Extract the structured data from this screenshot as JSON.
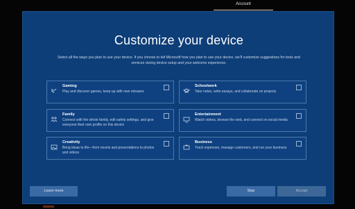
{
  "header": {
    "account_label": "Account"
  },
  "page": {
    "title": "Customize your device",
    "subtitle": "Select all the ways you plan to use your device. If you choose to tell Microsoft how you plan to use your device, we'll customize suggestions for tools and services during device setup and your welcome experience."
  },
  "options": [
    {
      "name": "Gaming",
      "desc": "Play and discover games, keep up with new releases",
      "icon": "gamepad-icon",
      "checked": false
    },
    {
      "name": "Schoolwork",
      "desc": "Take notes, write essays, and collaborate on projects",
      "icon": "graduation-cap-icon",
      "checked": false
    },
    {
      "name": "Family",
      "desc": "Connect with the whole family, edit safety settings, and give everyone their own profile on this device",
      "icon": "family-icon",
      "checked": false
    },
    {
      "name": "Entertainment",
      "desc": "Watch videos, browse the web, and connect on social media",
      "icon": "monitor-icon",
      "checked": false
    },
    {
      "name": "Creativity",
      "desc": "Bring ideas to life—from novels and presentations to photos and videos",
      "icon": "photo-icon",
      "checked": false
    },
    {
      "name": "Business",
      "desc": "Track expenses, manage customers, and run your business",
      "icon": "briefcase-icon",
      "checked": false
    }
  ],
  "footer": {
    "learn_more": "Learn more",
    "skip": "Skip",
    "accept": "Accept"
  },
  "colors": {
    "panel_bg": "#0e3e78",
    "card_border": "#4b7ab0",
    "button_bg": "#3a6aa3"
  }
}
